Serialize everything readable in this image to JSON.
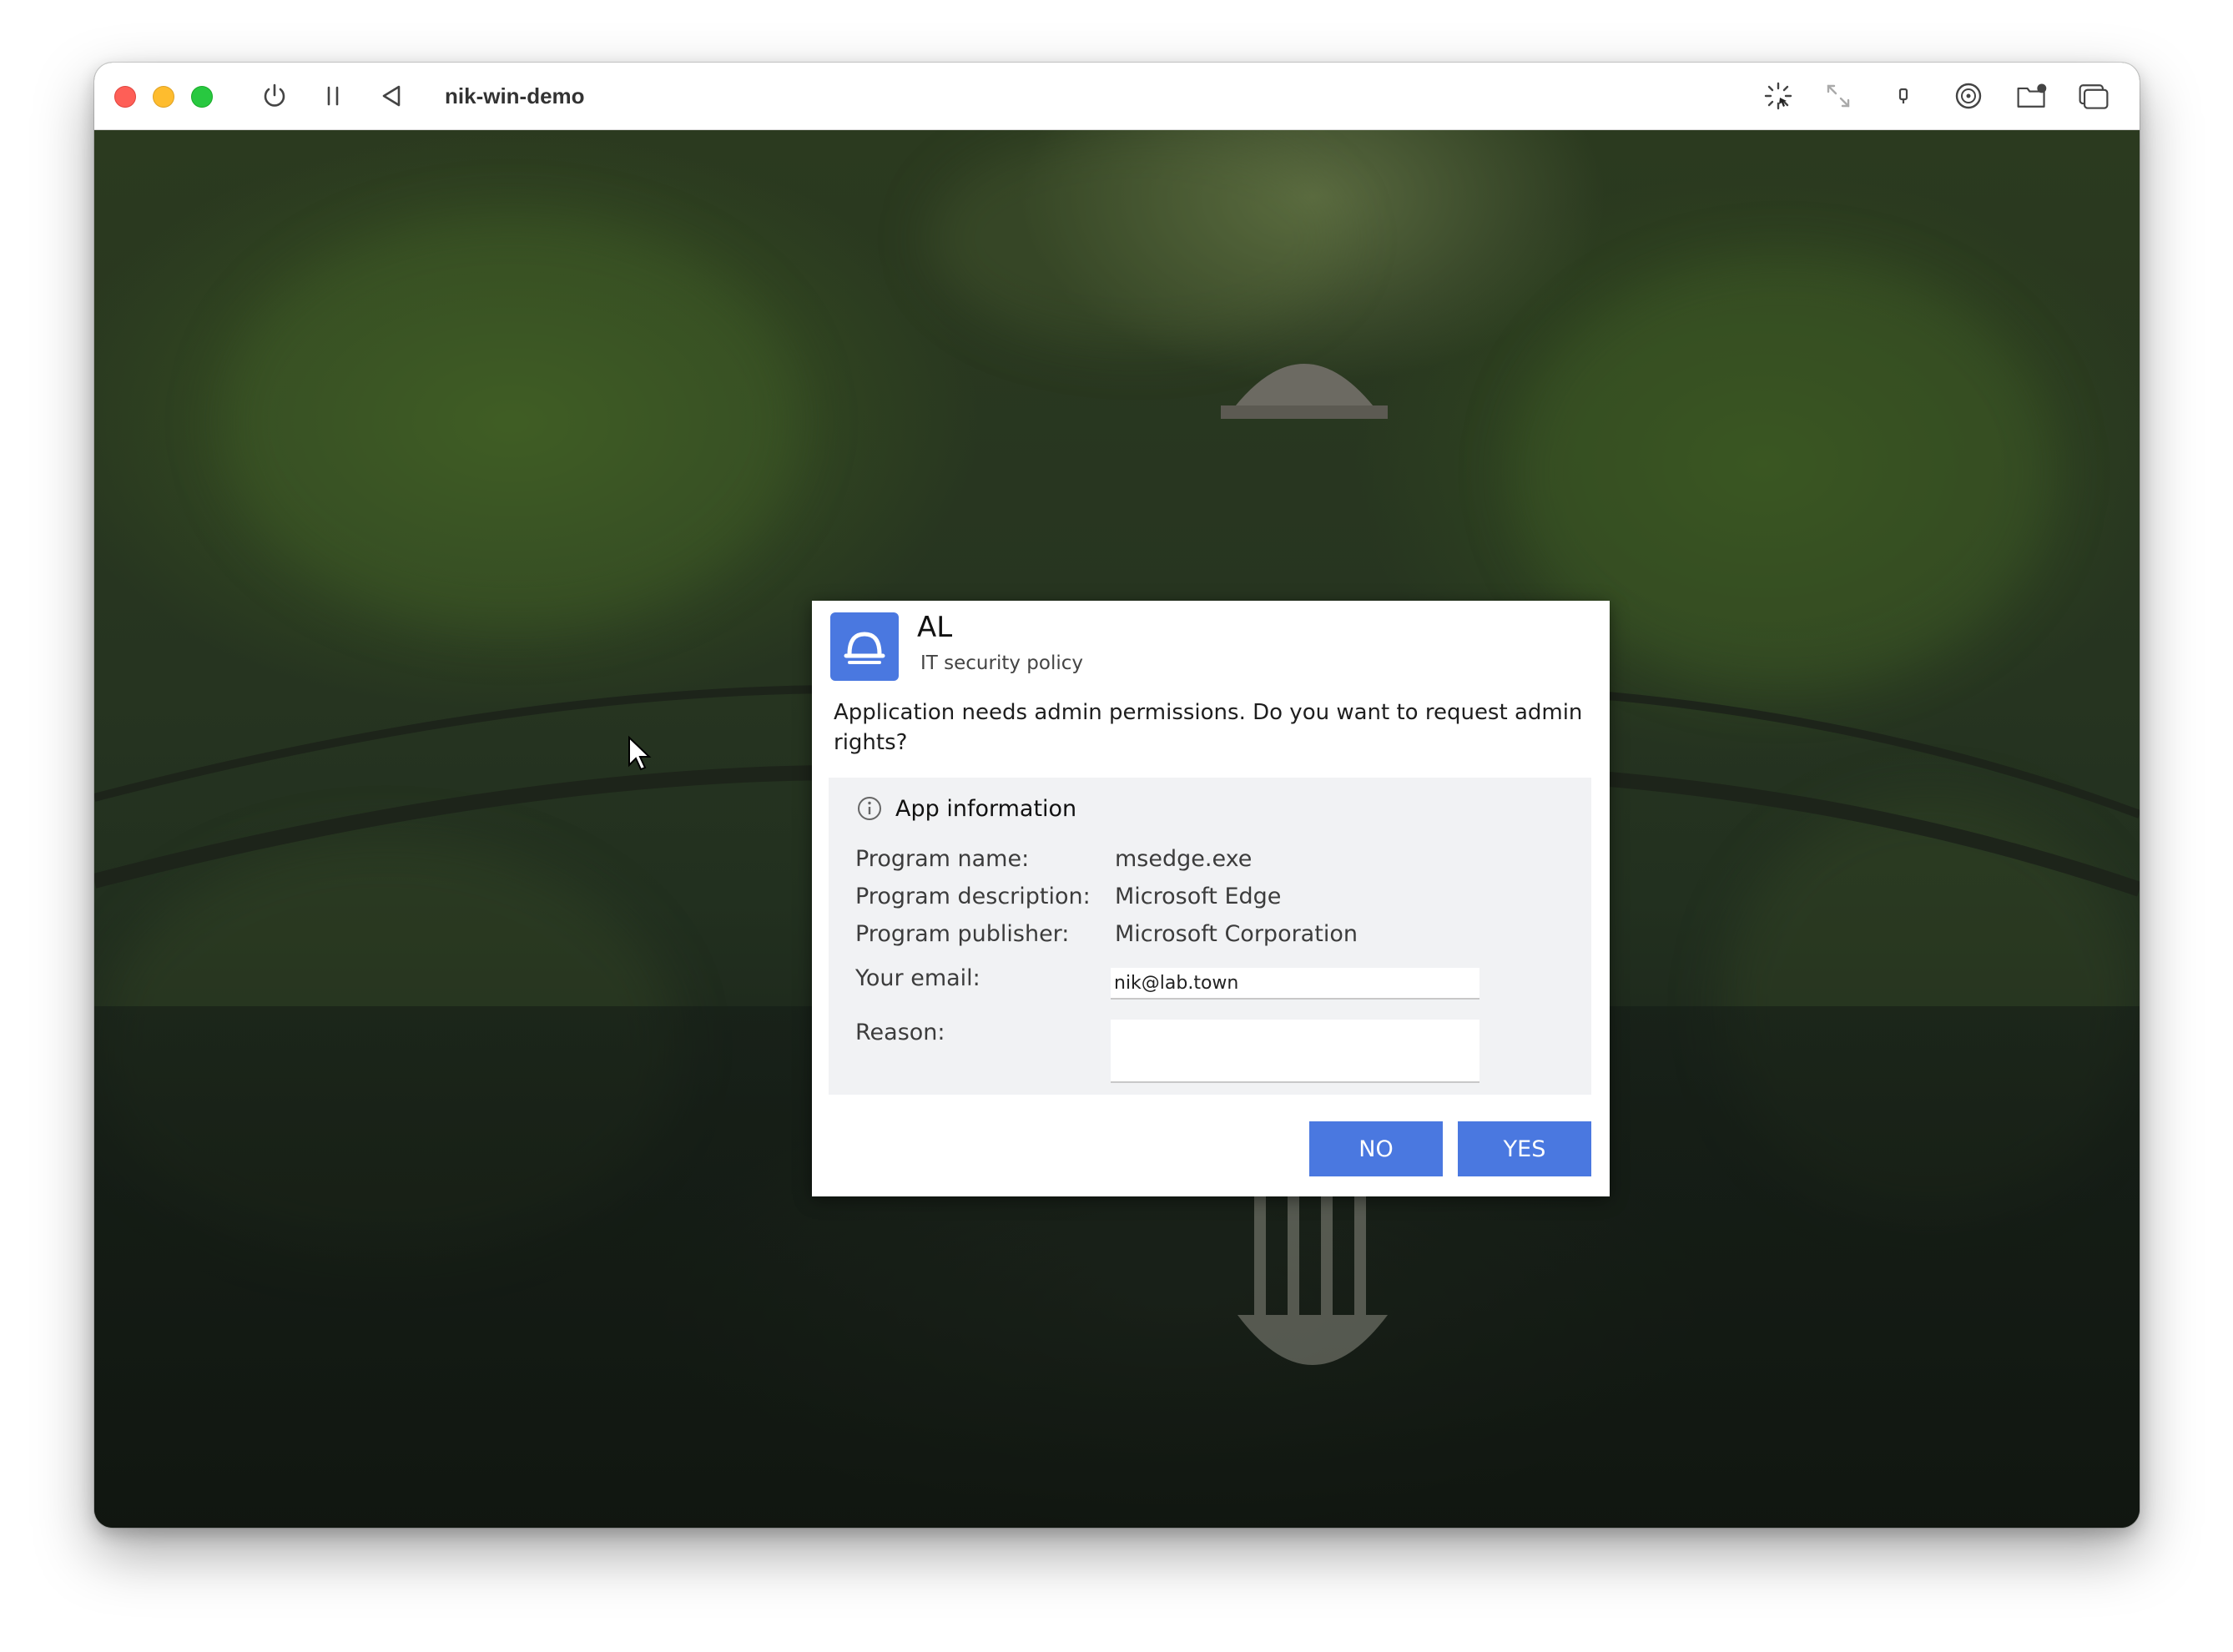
{
  "titlebar": {
    "title": "nik-win-demo",
    "controls": [
      "power-icon",
      "pause-icon",
      "back-icon"
    ],
    "tools": [
      "loading-spinner-icon",
      "resize-icon",
      "usb-icon",
      "disc-icon",
      "shared-folder-icon",
      "windows-icon"
    ]
  },
  "dialog": {
    "app_name": "AL",
    "subtitle": "IT security policy",
    "message": "Application needs admin permissions. Do you want to request admin rights?",
    "info": {
      "heading": "App information",
      "program_name_label": "Program name:",
      "program_name": "msedge.exe",
      "program_description_label": "Program description:",
      "program_description": "Microsoft Edge",
      "program_publisher_label": "Program publisher:",
      "program_publisher": "Microsoft Corporation",
      "email_label": "Your email:",
      "email_value": "nik@lab.town",
      "reason_label": "Reason:",
      "reason_value": ""
    },
    "buttons": {
      "no": "NO",
      "yes": "YES"
    },
    "accent_color": "#4a78e0"
  }
}
